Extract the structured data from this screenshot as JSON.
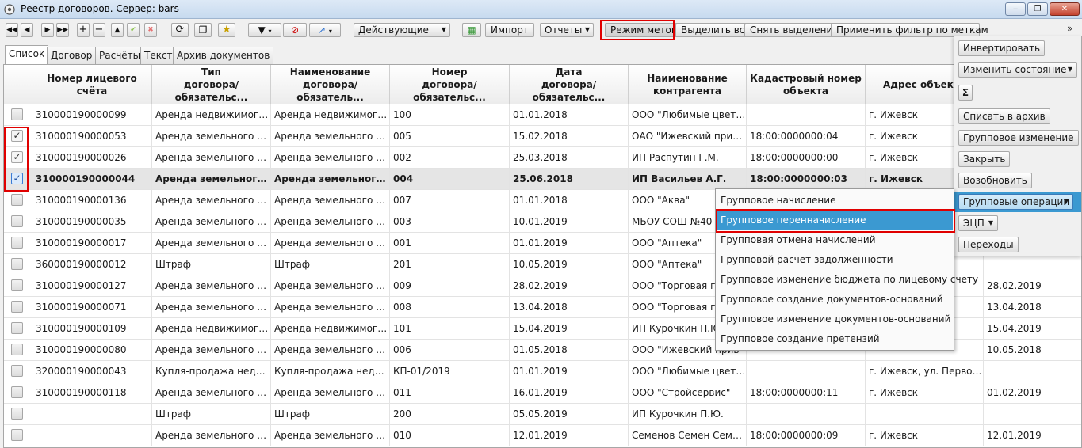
{
  "window": {
    "title": "Реестр договоров. Сервер: bars",
    "minimize": "‒",
    "maximize": "❐",
    "close": "✕"
  },
  "toolbar": {
    "filter_select": "Действующие",
    "import_label": "Импорт",
    "reports_label": "Отчеты",
    "marks_mode_label": "Режим меток",
    "select_all_label": "Выделить все",
    "clear_selection_label": "Снять выделение",
    "apply_mark_filter_label": "Применить фильтр по меткам",
    "overflow": "»"
  },
  "tabs": [
    "Список",
    "Договор",
    "Расчёты",
    "Текст",
    "Архив документов"
  ],
  "columns": [
    "Номер лицевого счёта",
    "Тип\nдоговора/обязательс...",
    "Наименование\nдоговора/обязатель...",
    "Номер\nдоговора/обязательс...",
    "Дата\nдоговора/обязательс...",
    "Наименование\nконтрагента",
    "Кадастровый номер\nобъекта",
    "Адрес объекта",
    ""
  ],
  "rows": [
    {
      "checked": false,
      "bold": false,
      "cells": [
        "310000190000099",
        "Аренда недвижимого и...",
        "Аренда недвижимого и...",
        "100",
        "01.01.2018",
        "ООО \"Любимые цветы\"",
        "",
        "г. Ижевск",
        ""
      ]
    },
    {
      "checked": true,
      "bold": false,
      "cells": [
        "310000190000053",
        "Аренда земельного уча...",
        "Аренда земельного уча...",
        "005",
        "15.02.2018",
        "ОАО \"Ижевский прибо...",
        "18:00:0000000:04",
        "г. Ижевск",
        ""
      ]
    },
    {
      "checked": true,
      "bold": false,
      "cells": [
        "310000190000026",
        "Аренда земельного уча...",
        "Аренда земельного уча...",
        "002",
        "25.03.2018",
        "ИП Распутин Г.М.",
        "18:00:0000000:00",
        "г. Ижевск",
        ""
      ]
    },
    {
      "checked": true,
      "bold": true,
      "cells": [
        "310000190000044",
        "Аренда земельного у...",
        "Аренда земельного у...",
        "004",
        "25.06.2018",
        "ИП Васильев А.Г.",
        "18:00:0000000:03",
        "г. Ижевск",
        ""
      ]
    },
    {
      "checked": false,
      "bold": false,
      "cells": [
        "310000190000136",
        "Аренда земельного уча...",
        "Аренда земельного уча...",
        "007",
        "01.01.2018",
        "ООО \"Аква\"",
        "",
        "",
        ""
      ]
    },
    {
      "checked": false,
      "bold": false,
      "cells": [
        "310000190000035",
        "Аренда земельного уча...",
        "Аренда земельного уча...",
        "003",
        "10.01.2019",
        "МБОУ СОШ №40",
        "",
        "",
        ""
      ]
    },
    {
      "checked": false,
      "bold": false,
      "cells": [
        "310000190000017",
        "Аренда земельного уча...",
        "Аренда земельного уча...",
        "001",
        "01.01.2019",
        "ООО \"Аптека\"",
        "",
        "",
        ""
      ]
    },
    {
      "checked": false,
      "bold": false,
      "cells": [
        "360000190000012",
        "Штраф",
        "Штраф",
        "201",
        "10.05.2019",
        "ООО \"Аптека\"",
        "",
        "",
        ""
      ]
    },
    {
      "checked": false,
      "bold": false,
      "cells": [
        "310000190000127",
        "Аренда земельного уча...",
        "Аренда земельного уча...",
        "009",
        "28.02.2019",
        "ООО \"Торговая гал",
        "",
        "",
        "28.02.2019"
      ]
    },
    {
      "checked": false,
      "bold": false,
      "cells": [
        "310000190000071",
        "Аренда земельного уча...",
        "Аренда земельного уча...",
        "008",
        "13.04.2018",
        "ООО \"Торговая гал",
        "",
        "",
        "13.04.2018"
      ]
    },
    {
      "checked": false,
      "bold": false,
      "cells": [
        "310000190000109",
        "Аренда недвижимого и...",
        "Аренда недвижимого и...",
        "101",
        "15.04.2019",
        "ИП Курочкин П.Ю.",
        "",
        "",
        "15.04.2019"
      ]
    },
    {
      "checked": false,
      "bold": false,
      "cells": [
        "310000190000080",
        "Аренда земельного уча...",
        "Аренда земельного уча...",
        "006",
        "01.05.2018",
        "ООО \"Ижевский прив",
        "",
        "",
        "10.05.2018"
      ]
    },
    {
      "checked": false,
      "bold": false,
      "cells": [
        "320000190000043",
        "Купля-продажа недвиж...",
        "Купля-продажа недвиж...",
        "КП-01/2019",
        "01.01.2019",
        "ООО \"Любимые цветы\"",
        "",
        "г. Ижевск, ул. Первомая...",
        ""
      ]
    },
    {
      "checked": false,
      "bold": false,
      "cells": [
        "310000190000118",
        "Аренда земельного уча...",
        "Аренда земельного уча...",
        "011",
        "16.01.2019",
        "ООО \"Стройсервис\"",
        "18:00:0000000:11",
        "г. Ижевск",
        "01.02.2019"
      ]
    },
    {
      "checked": false,
      "bold": false,
      "cells": [
        "",
        "Штраф",
        "Штраф",
        "200",
        "05.05.2019",
        "ИП Курочкин П.Ю.",
        "",
        "",
        ""
      ]
    },
    {
      "checked": false,
      "bold": false,
      "cells": [
        "",
        "Аренда земельного уча...",
        "Аренда земельного уча...",
        "010",
        "12.01.2019",
        "Семенов Семен Семено...",
        "18:00:0000000:09",
        "г. Ижевск",
        "12.01.2019"
      ]
    }
  ],
  "right_panel": {
    "invert": "Инвертировать",
    "change_state": "Изменить состояние",
    "sum_icon": "Σ",
    "archive": "Списать в архив",
    "group_change": "Групповое изменение",
    "close": "Закрыть",
    "resume": "Возобновить",
    "group_ops": "Групповые операции",
    "eds": "ЭЦП",
    "transitions": "Переходы"
  },
  "menu": {
    "items": [
      "Групповое начисление",
      "Групповое перенначисление",
      "Групповая отмена начислений",
      "Групповой расчет задолженности",
      "Групповое изменение бюджета по лицевому счету",
      "Групповое создание документов-оснований",
      "Групповое изменение документов-оснований",
      "Групповое создание претензий"
    ],
    "selected_index": 1
  },
  "colors": {
    "highlight_blue": "#3b99d1",
    "annotation_red": "#e00000"
  }
}
